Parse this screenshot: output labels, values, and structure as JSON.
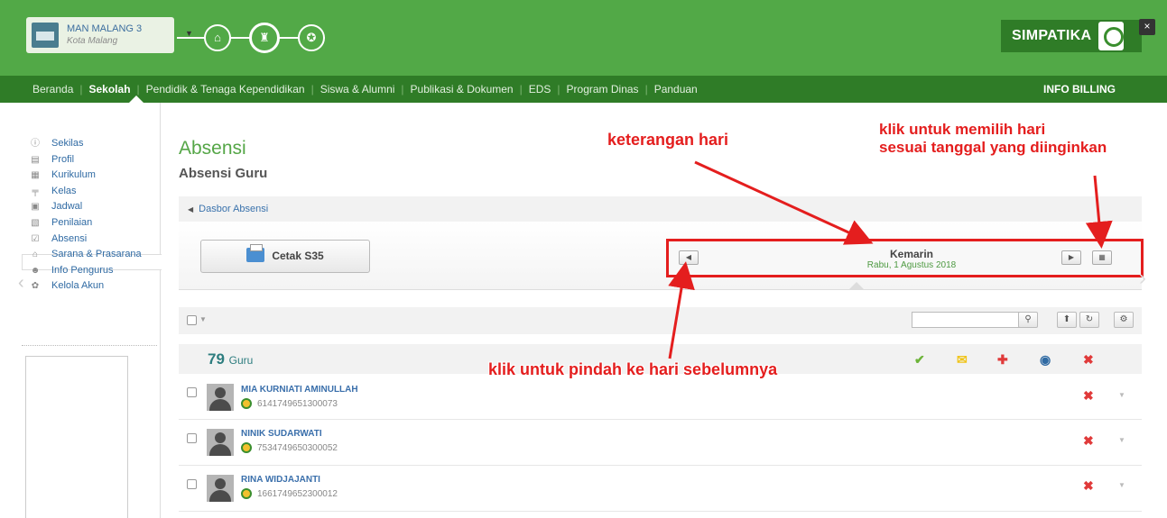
{
  "header": {
    "school_name": "MAN MALANG 3",
    "school_city": "Kota Malang",
    "brand": "SIMPATIKA",
    "close": "×",
    "billing": "INFO BILLING"
  },
  "nav": {
    "items": [
      "Beranda",
      "Sekolah",
      "Pendidik & Tenaga Kependidikan",
      "Siswa & Alumni",
      "Publikasi & Dokumen",
      "EDS",
      "Program Dinas",
      "Panduan"
    ],
    "active": "Sekolah"
  },
  "sidebar": {
    "items": [
      {
        "label": "Sekilas",
        "icon": "info-icon"
      },
      {
        "label": "Profil",
        "icon": "profile-icon"
      },
      {
        "label": "Kurikulum",
        "icon": "book-icon"
      },
      {
        "label": "Kelas",
        "icon": "class-icon"
      },
      {
        "label": "Jadwal",
        "icon": "calendar-icon"
      },
      {
        "label": "Penilaian",
        "icon": "grade-icon"
      },
      {
        "label": "Absensi",
        "icon": "checklist-icon"
      },
      {
        "label": "Sarana & Prasarana",
        "icon": "building-icon"
      },
      {
        "label": "Info Pengurus",
        "icon": "person-icon"
      },
      {
        "label": "Kelola Akun",
        "icon": "account-icon"
      }
    ],
    "active": "Absensi"
  },
  "main": {
    "title": "Absensi",
    "subtitle": "Absensi Guru",
    "breadcrumb": "Dasbor Absensi",
    "print_button": "Cetak S35",
    "day_label": "Kemarin",
    "day_date": "Rabu, 1 Agustus 2018",
    "count": "79",
    "count_label": "Guru"
  },
  "teachers": [
    {
      "name": "MIA KURNIATI AMINULLAH",
      "nip": "6141749651300073"
    },
    {
      "name": "NINIK SUDARWATI",
      "nip": "7534749650300052"
    },
    {
      "name": "RINA WIDJAJANTI",
      "nip": "1661749652300012"
    }
  ],
  "annotations": {
    "day_info": "keterangan hari",
    "pick_day_1": "klik untuk memilih hari",
    "pick_day_2": "sesuai tanggal yang diinginkan",
    "prev_day": "klik untuk pindah ke hari sebelumnya"
  },
  "colors": {
    "primary_green": "#52a947",
    "dark_green": "#2f7c27",
    "annotation_red": "#e41e1e"
  }
}
